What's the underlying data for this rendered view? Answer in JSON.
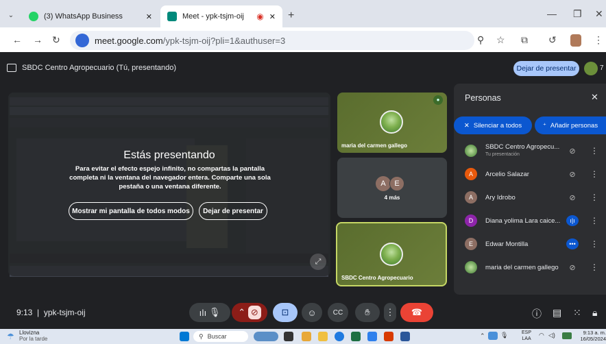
{
  "browser": {
    "tabs": [
      {
        "label": "(3) WhatsApp Business",
        "favicon_color": "#25d366"
      },
      {
        "label": "Meet - ypk-tsjm-oij",
        "favicon_color": "#00897b"
      }
    ],
    "url_domain": "meet.google.com",
    "url_path": "/ypk-tsjm-oij?pli=1&authuser=3"
  },
  "meet": {
    "presenting_label": "SBDC Centro Agropecuario (Tú, presentando)",
    "stop_presenting": "Dejar de presentar",
    "people_count": "7",
    "overlay": {
      "title": "Estás presentando",
      "message": "Para evitar el efecto espejo infinito, no compartas la pantalla completa ni la ventana del navegador entera. Comparte una sola pestaña o una ventana diferente.",
      "show_anyway": "Mostrar mi pantalla de todos modos",
      "stop": "Dejar de presentar"
    },
    "tiles": [
      {
        "name": "maria del carmen gallego"
      },
      {
        "name": "4 más",
        "initials": [
          "A",
          "E"
        ]
      },
      {
        "name": "SBDC Centro Agropecuario"
      }
    ],
    "meeting_time": "9:13",
    "meeting_code": "ypk-tsjm-oij"
  },
  "people_panel": {
    "title": "Personas",
    "mute_all": "Silenciar a todos",
    "add_people": "Añadir personas",
    "participants": [
      {
        "name": "SBDC Centro Agropecu...",
        "sub": "Tu presentación",
        "initial": "",
        "color": "#6aa84f"
      },
      {
        "name": "Arcelio Salazar",
        "initial": "A",
        "color": "#e8590c"
      },
      {
        "name": "Ary Idrobo",
        "initial": "A",
        "color": "#8d6e63"
      },
      {
        "name": "Diana yolima Lara caice...",
        "initial": "D",
        "color": "#8e24aa"
      },
      {
        "name": "Edwar Montilla",
        "initial": "E",
        "color": "#8d6e63"
      },
      {
        "name": "maria del carmen gallego",
        "initial": "",
        "color": "#6aa84f"
      }
    ]
  },
  "taskbar": {
    "weather": "Llovizna",
    "weather_sub": "Por la tarde",
    "search": "Buscar",
    "lang": "ESP",
    "lang_sub": "LAA",
    "time": "9:13 a. m.",
    "date": "16/05/2024"
  },
  "colors": {
    "accent": "#a8c7fa",
    "hangup": "#ea4335",
    "active_tile": "#a8c7fa"
  }
}
